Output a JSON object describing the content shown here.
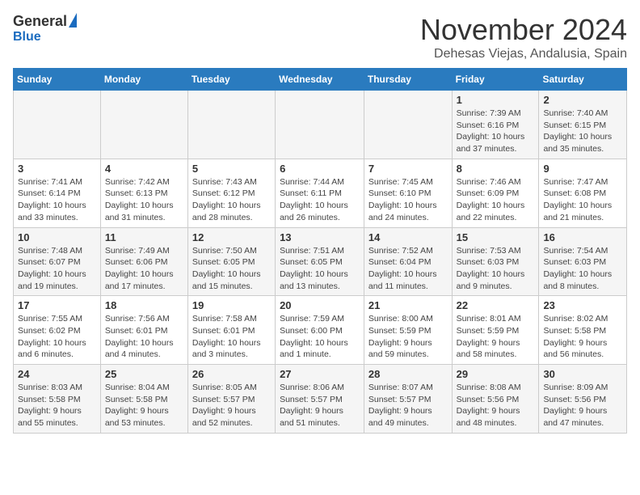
{
  "header": {
    "logo_general": "General",
    "logo_blue": "Blue",
    "title": "November 2024",
    "subtitle": "Dehesas Viejas, Andalusia, Spain"
  },
  "weekdays": [
    "Sunday",
    "Monday",
    "Tuesday",
    "Wednesday",
    "Thursday",
    "Friday",
    "Saturday"
  ],
  "weeks": [
    [
      {
        "day": "",
        "info": ""
      },
      {
        "day": "",
        "info": ""
      },
      {
        "day": "",
        "info": ""
      },
      {
        "day": "",
        "info": ""
      },
      {
        "day": "",
        "info": ""
      },
      {
        "day": "1",
        "info": "Sunrise: 7:39 AM\nSunset: 6:16 PM\nDaylight: 10 hours and 37 minutes."
      },
      {
        "day": "2",
        "info": "Sunrise: 7:40 AM\nSunset: 6:15 PM\nDaylight: 10 hours and 35 minutes."
      }
    ],
    [
      {
        "day": "3",
        "info": "Sunrise: 7:41 AM\nSunset: 6:14 PM\nDaylight: 10 hours and 33 minutes."
      },
      {
        "day": "4",
        "info": "Sunrise: 7:42 AM\nSunset: 6:13 PM\nDaylight: 10 hours and 31 minutes."
      },
      {
        "day": "5",
        "info": "Sunrise: 7:43 AM\nSunset: 6:12 PM\nDaylight: 10 hours and 28 minutes."
      },
      {
        "day": "6",
        "info": "Sunrise: 7:44 AM\nSunset: 6:11 PM\nDaylight: 10 hours and 26 minutes."
      },
      {
        "day": "7",
        "info": "Sunrise: 7:45 AM\nSunset: 6:10 PM\nDaylight: 10 hours and 24 minutes."
      },
      {
        "day": "8",
        "info": "Sunrise: 7:46 AM\nSunset: 6:09 PM\nDaylight: 10 hours and 22 minutes."
      },
      {
        "day": "9",
        "info": "Sunrise: 7:47 AM\nSunset: 6:08 PM\nDaylight: 10 hours and 21 minutes."
      }
    ],
    [
      {
        "day": "10",
        "info": "Sunrise: 7:48 AM\nSunset: 6:07 PM\nDaylight: 10 hours and 19 minutes."
      },
      {
        "day": "11",
        "info": "Sunrise: 7:49 AM\nSunset: 6:06 PM\nDaylight: 10 hours and 17 minutes."
      },
      {
        "day": "12",
        "info": "Sunrise: 7:50 AM\nSunset: 6:05 PM\nDaylight: 10 hours and 15 minutes."
      },
      {
        "day": "13",
        "info": "Sunrise: 7:51 AM\nSunset: 6:05 PM\nDaylight: 10 hours and 13 minutes."
      },
      {
        "day": "14",
        "info": "Sunrise: 7:52 AM\nSunset: 6:04 PM\nDaylight: 10 hours and 11 minutes."
      },
      {
        "day": "15",
        "info": "Sunrise: 7:53 AM\nSunset: 6:03 PM\nDaylight: 10 hours and 9 minutes."
      },
      {
        "day": "16",
        "info": "Sunrise: 7:54 AM\nSunset: 6:03 PM\nDaylight: 10 hours and 8 minutes."
      }
    ],
    [
      {
        "day": "17",
        "info": "Sunrise: 7:55 AM\nSunset: 6:02 PM\nDaylight: 10 hours and 6 minutes."
      },
      {
        "day": "18",
        "info": "Sunrise: 7:56 AM\nSunset: 6:01 PM\nDaylight: 10 hours and 4 minutes."
      },
      {
        "day": "19",
        "info": "Sunrise: 7:58 AM\nSunset: 6:01 PM\nDaylight: 10 hours and 3 minutes."
      },
      {
        "day": "20",
        "info": "Sunrise: 7:59 AM\nSunset: 6:00 PM\nDaylight: 10 hours and 1 minute."
      },
      {
        "day": "21",
        "info": "Sunrise: 8:00 AM\nSunset: 5:59 PM\nDaylight: 9 hours and 59 minutes."
      },
      {
        "day": "22",
        "info": "Sunrise: 8:01 AM\nSunset: 5:59 PM\nDaylight: 9 hours and 58 minutes."
      },
      {
        "day": "23",
        "info": "Sunrise: 8:02 AM\nSunset: 5:58 PM\nDaylight: 9 hours and 56 minutes."
      }
    ],
    [
      {
        "day": "24",
        "info": "Sunrise: 8:03 AM\nSunset: 5:58 PM\nDaylight: 9 hours and 55 minutes."
      },
      {
        "day": "25",
        "info": "Sunrise: 8:04 AM\nSunset: 5:58 PM\nDaylight: 9 hours and 53 minutes."
      },
      {
        "day": "26",
        "info": "Sunrise: 8:05 AM\nSunset: 5:57 PM\nDaylight: 9 hours and 52 minutes."
      },
      {
        "day": "27",
        "info": "Sunrise: 8:06 AM\nSunset: 5:57 PM\nDaylight: 9 hours and 51 minutes."
      },
      {
        "day": "28",
        "info": "Sunrise: 8:07 AM\nSunset: 5:57 PM\nDaylight: 9 hours and 49 minutes."
      },
      {
        "day": "29",
        "info": "Sunrise: 8:08 AM\nSunset: 5:56 PM\nDaylight: 9 hours and 48 minutes."
      },
      {
        "day": "30",
        "info": "Sunrise: 8:09 AM\nSunset: 5:56 PM\nDaylight: 9 hours and 47 minutes."
      }
    ]
  ]
}
